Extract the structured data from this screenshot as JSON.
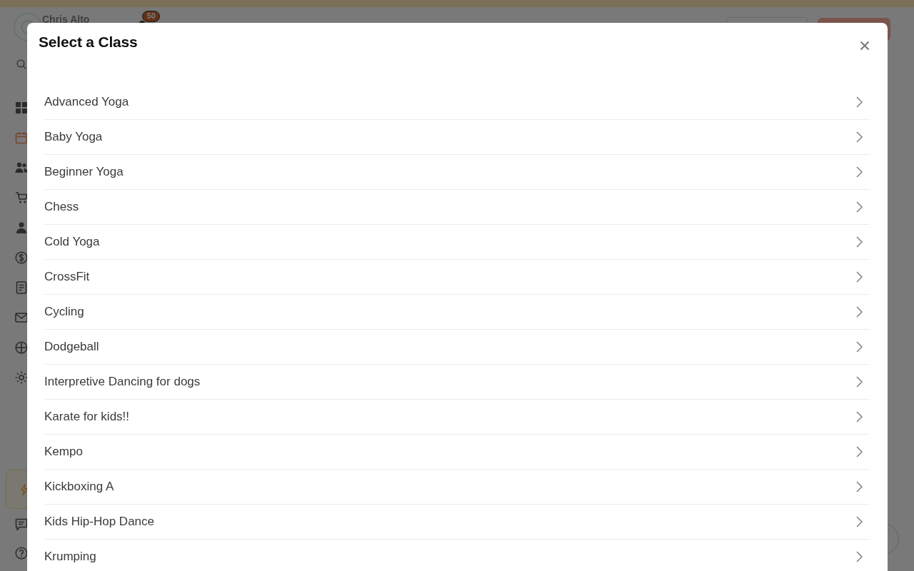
{
  "app": {
    "user": {
      "name": "Chris Alto"
    },
    "notifications": {
      "count": "50"
    },
    "sidebar": {
      "items": [
        {
          "selected": false
        },
        {
          "selected": true
        },
        {
          "selected": false
        },
        {
          "selected": false
        },
        {
          "selected": false
        },
        {
          "selected": false
        },
        {
          "selected": false
        },
        {
          "selected": false
        },
        {
          "selected": false
        },
        {
          "selected": false
        }
      ]
    }
  },
  "modal": {
    "title": "Select a Class",
    "classes": [
      {
        "name": "Advanced Yoga"
      },
      {
        "name": "Baby Yoga"
      },
      {
        "name": "Beginner Yoga"
      },
      {
        "name": "Chess"
      },
      {
        "name": "Cold Yoga"
      },
      {
        "name": "CrossFit"
      },
      {
        "name": "Cycling"
      },
      {
        "name": "Dodgeball"
      },
      {
        "name": "Interpretive Dancing for dogs"
      },
      {
        "name": "Karate for kids!!"
      },
      {
        "name": "Kempo"
      },
      {
        "name": "Kickboxing A"
      },
      {
        "name": "Kids Hip-Hop Dance"
      },
      {
        "name": "Krumping"
      }
    ]
  }
}
